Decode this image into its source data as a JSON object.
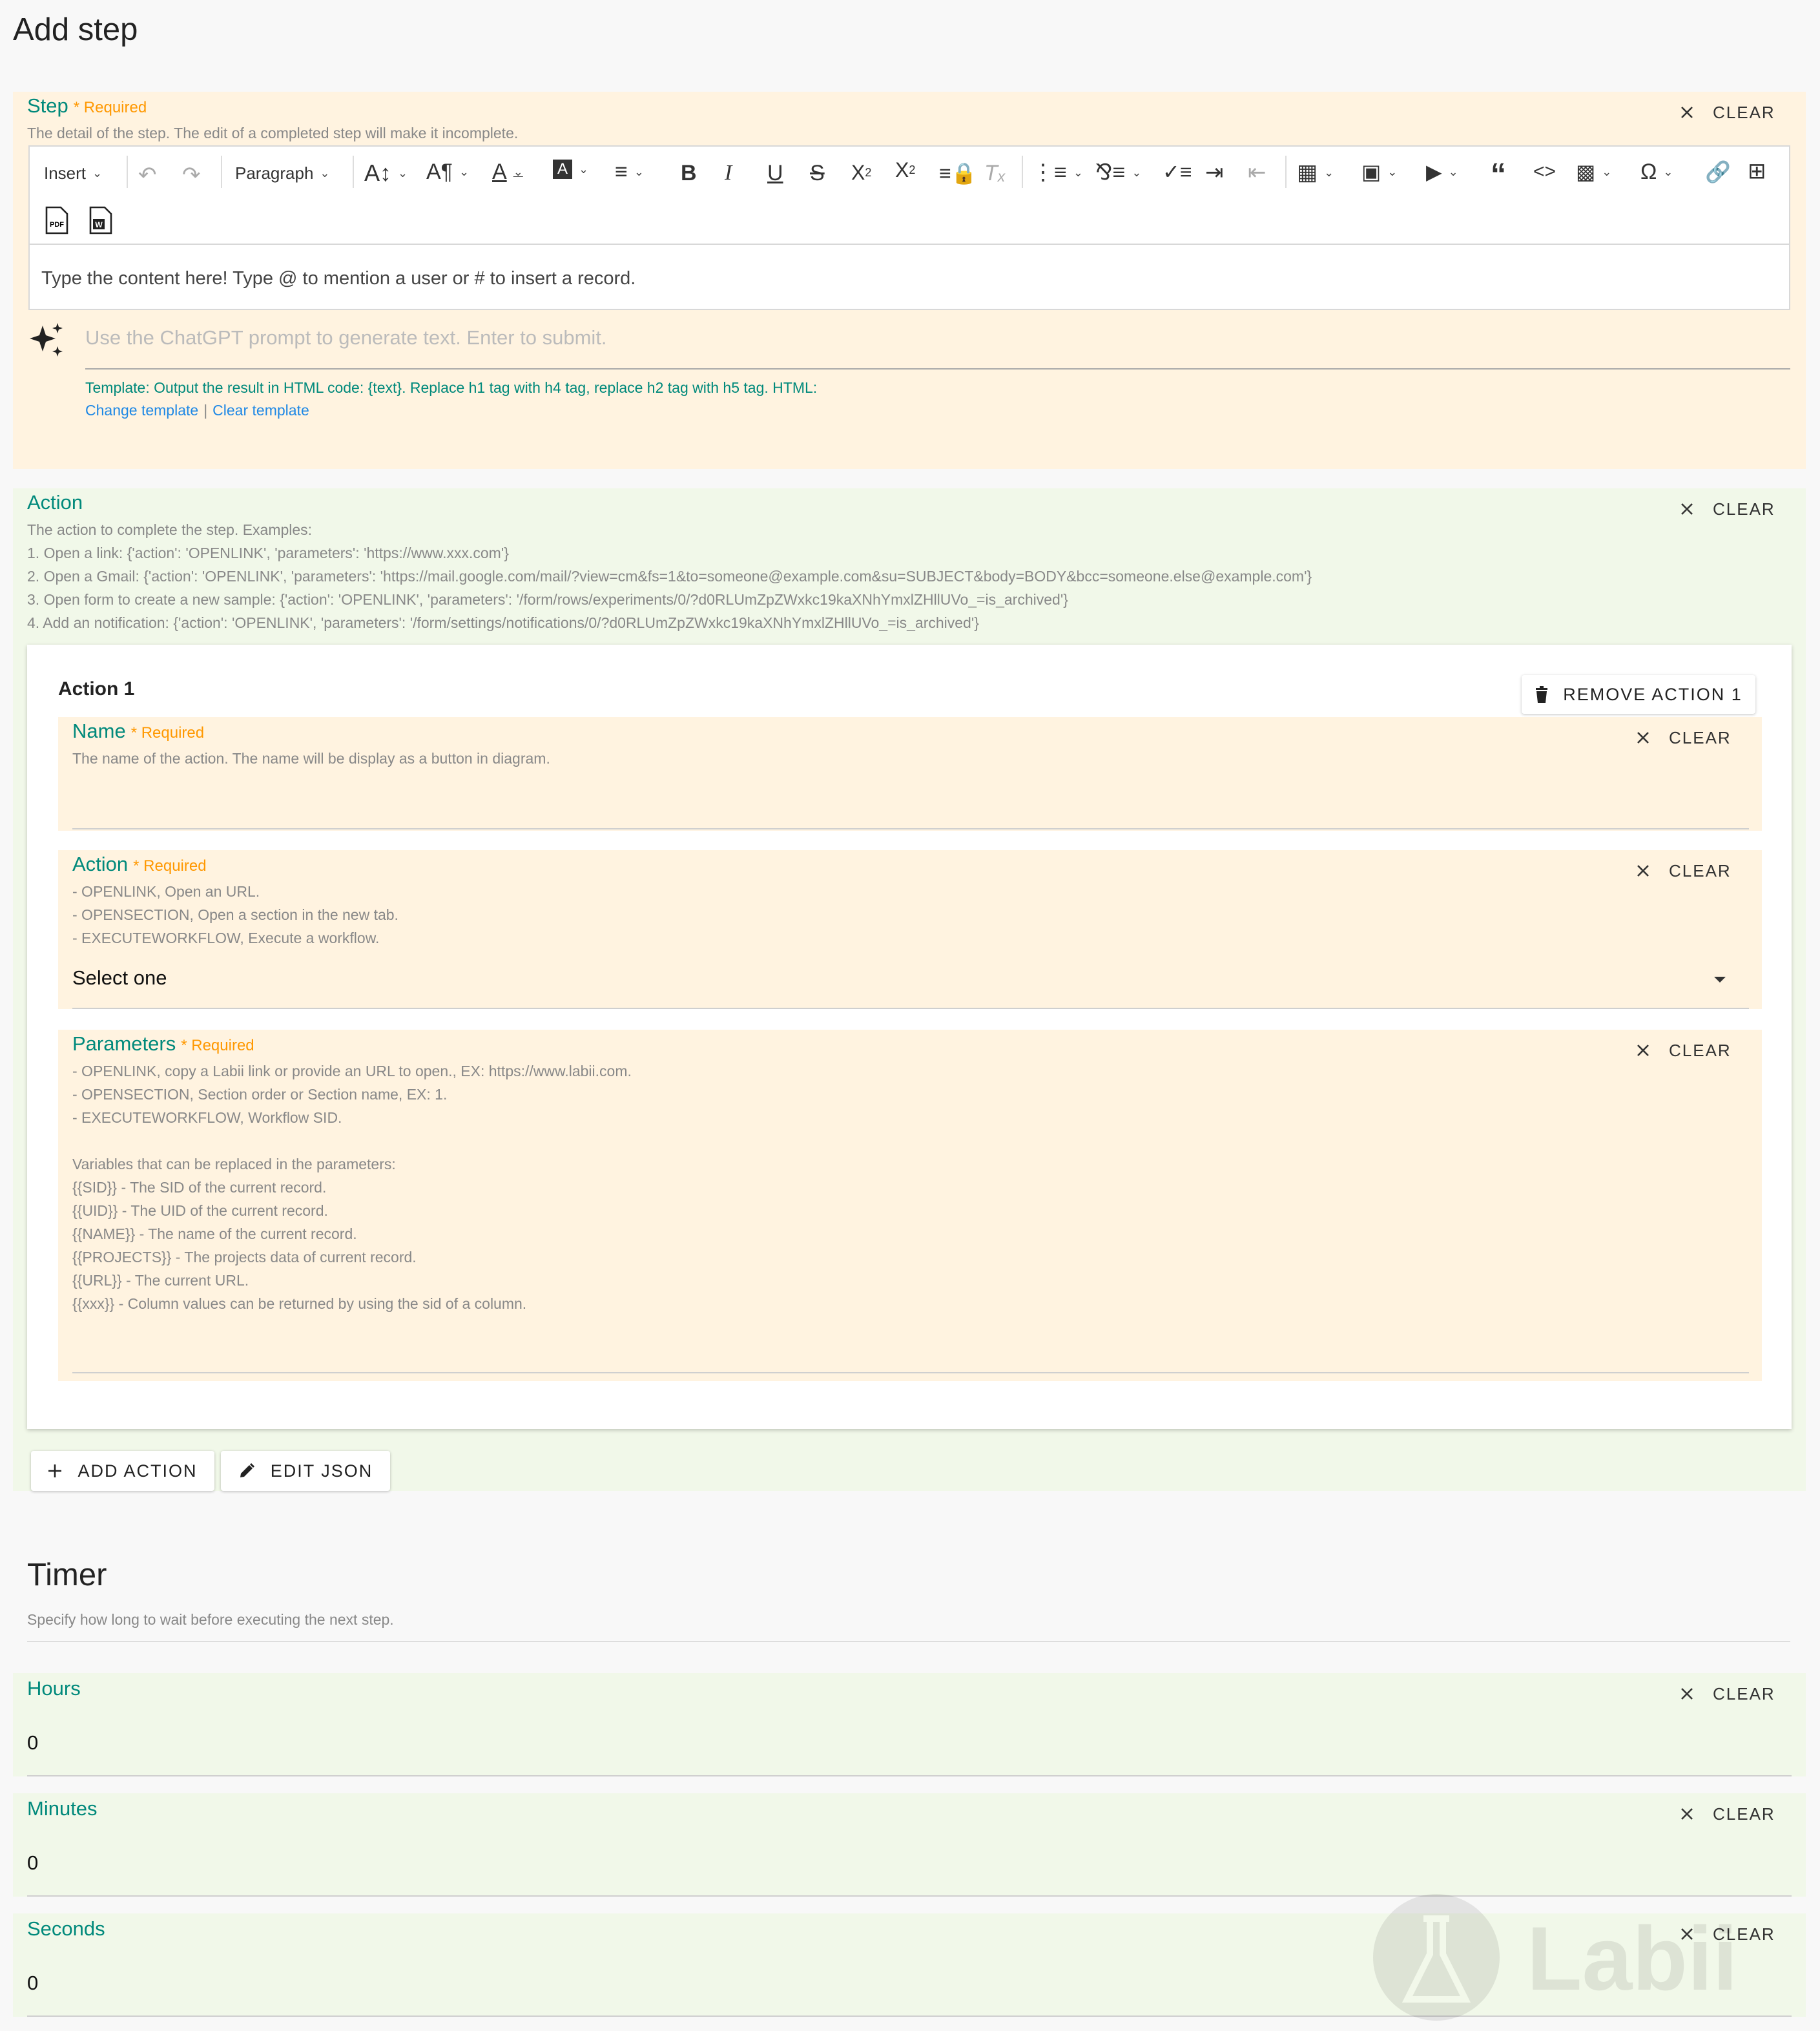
{
  "page": {
    "title": "Add step"
  },
  "step_field": {
    "label": "Step",
    "required": "* Required",
    "description": "The detail of the step. The edit of a completed step will make it incomplete.",
    "clear": "CLEAR",
    "toolbar": {
      "insert": "Insert",
      "paragraph": "Paragraph"
    },
    "placeholder": "Type the content here! Type @ to mention a user or # to insert a record.",
    "ai_placeholder": "Use the ChatGPT prompt to generate text. Enter to submit.",
    "template": "Template: Output the result in HTML code: {text}. Replace h1 tag with h4 tag, replace h2 tag with h5 tag. HTML:",
    "change_template": "Change template",
    "link_sep": "|",
    "clear_template": "Clear template"
  },
  "action_field": {
    "label": "Action",
    "clear": "CLEAR",
    "description": "The action to complete the step. Examples:\n1. Open a link: {'action': 'OPENLINK', 'parameters': 'https://www.xxx.com'}\n2. Open a Gmail: {'action': 'OPENLINK', 'parameters': 'https://mail.google.com/mail/?view=cm&fs=1&to=someone@example.com&su=SUBJECT&body=BODY&bcc=someone.else@example.com'}\n3. Open form to create a new sample: {'action': 'OPENLINK', 'parameters': '/form/rows/experiments/0/?d0RLUmZpZWxkc19kaXNhYmxlZHllUVo_=is_archived'}\n4. Add an notification: {'action': 'OPENLINK', 'parameters': '/form/settings/notifications/0/?d0RLUmZpZWxkc19kaXNhYmxlZHllUVo_=is_archived'}",
    "card": {
      "title": "Action 1",
      "remove": "REMOVE ACTION 1",
      "name": {
        "label": "Name",
        "required": "* Required",
        "description": "The name of the action. The name will be display as a button in diagram.",
        "clear": "CLEAR"
      },
      "action": {
        "label": "Action",
        "required": "* Required",
        "description": "- OPENLINK, Open an URL.\n- OPENSECTION, Open a section in the new tab.\n- EXECUTEWORKFLOW, Execute a workflow.",
        "clear": "CLEAR",
        "value": "Select one"
      },
      "parameters": {
        "label": "Parameters",
        "required": "* Required",
        "description": "- OPENLINK, copy a Labii link or provide an URL to open., EX: https://www.labii.com.\n- OPENSECTION, Section order or Section name, EX: 1.\n- EXECUTEWORKFLOW, Workflow SID.\n\nVariables that can be replaced in the parameters:\n{{SID}} - The SID of the current record.\n{{UID}} - The UID of the current record.\n{{NAME}} - The name of the current record.\n{{PROJECTS}} - The projects data of current record.\n{{URL}} - The current URL.\n{{xxx}} - Column values can be returned by using the sid of a column.",
        "clear": "CLEAR"
      }
    },
    "add_action": "ADD ACTION",
    "edit_json": "EDIT JSON"
  },
  "timer": {
    "title": "Timer",
    "description": "Specify how long to wait before executing the next step.",
    "hours": {
      "label": "Hours",
      "value": "0",
      "clear": "CLEAR"
    },
    "minutes": {
      "label": "Minutes",
      "value": "0",
      "clear": "CLEAR"
    },
    "seconds": {
      "label": "Seconds",
      "value": "0",
      "clear": "CLEAR"
    }
  },
  "watermark": {
    "text": "Labii"
  },
  "colors": {
    "accent": "#00897b",
    "required": "#ff9800",
    "link": "#1e88e5",
    "orange_bg": "#fff3e0",
    "green_bg": "#f1f8e9"
  }
}
